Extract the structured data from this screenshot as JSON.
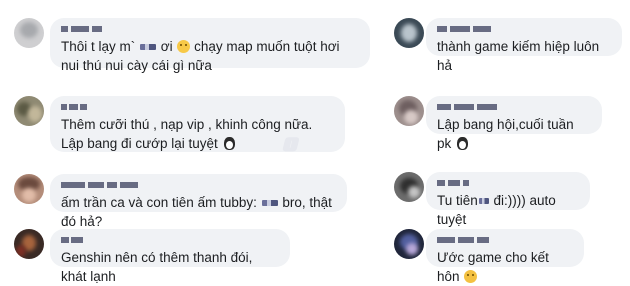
{
  "comments": [
    {
      "text": "Thôi t lạy m` ",
      "text2": " ơi ",
      "text3": " chạy map muốn tuột hơi nui thú nui cày cái gì nữa",
      "emoji": "smile-emoji"
    },
    {
      "text": "thành game kiếm hiệp luôn hả"
    },
    {
      "text": "Thêm cưỡi thú , nạp vip , khinh công nữa. Lập bang đi cướp lại tuyệt ",
      "emoji": "penguin-emoji"
    },
    {
      "text": "Lập bang hội,cuối tuần pk ",
      "emoji": "penguin-emoji"
    },
    {
      "text": "ấm trần ca và con tiên ấm tubby: ",
      "text2": " bro, thật đó hả?"
    },
    {
      "text": "Tu tiên",
      "text2": " đi:)))) auto tuyệt"
    },
    {
      "text": "Genshin nên có thêm thanh đói, khát lạnh"
    },
    {
      "text": "Ước game cho kết hôn ",
      "emoji": "smile-emoji"
    }
  ],
  "colors": {
    "bubble": "#f0f2f5",
    "text": "#1c1e21",
    "name_redacted": "#3b3f5c"
  }
}
